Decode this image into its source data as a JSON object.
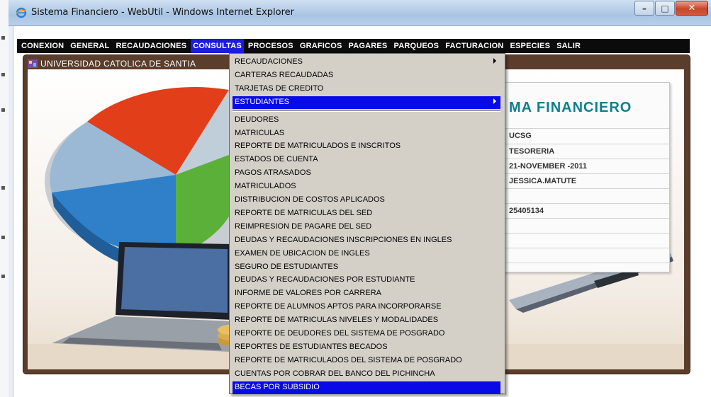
{
  "window": {
    "title": "Sistema Financiero - WebUtil - Windows Internet Explorer"
  },
  "menubar": {
    "items": [
      {
        "label": "CONEXION",
        "active": false
      },
      {
        "label": "GENERAL",
        "active": false
      },
      {
        "label": "RECAUDACIONES",
        "active": false
      },
      {
        "label": "CONSULTAS",
        "active": true
      },
      {
        "label": "PROCESOS",
        "active": false
      },
      {
        "label": "GRAFICOS",
        "active": false
      },
      {
        "label": "PAGARES",
        "active": false
      },
      {
        "label": "PARQUEOS",
        "active": false
      },
      {
        "label": "FACTURACION",
        "active": false
      },
      {
        "label": "ESPECIES",
        "active": false
      },
      {
        "label": "SALIR",
        "active": false
      }
    ]
  },
  "app": {
    "header": "UNIVERSIDAD CATOLICA DE SANTIA"
  },
  "card": {
    "title": "MA  FINANCIERO",
    "rows": [
      "UCSG",
      "TESORERIA",
      "21-NOVEMBER -2011",
      "JESSICA.MATUTE",
      "",
      "25405134",
      "",
      "",
      "",
      ""
    ]
  },
  "dropdown": {
    "items": [
      {
        "label": "RECAUDACIONES",
        "submenu": true,
        "highlighted": false
      },
      {
        "label": "CARTERAS RECAUDADAS",
        "submenu": false,
        "highlighted": false
      },
      {
        "label": "TARJETAS DE CREDITO",
        "submenu": false,
        "highlighted": false
      },
      {
        "label": "ESTUDIANTES",
        "submenu": true,
        "highlighted": true
      },
      {
        "label": "DEUDORES",
        "submenu": false,
        "highlighted": false
      },
      {
        "label": "MATRICULAS",
        "submenu": false,
        "highlighted": false
      },
      {
        "label": "REPORTE DE MATRICULADOS E INSCRITOS",
        "submenu": false,
        "highlighted": false
      },
      {
        "label": "ESTADOS DE CUENTA",
        "submenu": false,
        "highlighted": false
      },
      {
        "label": "PAGOS ATRASADOS",
        "submenu": false,
        "highlighted": false
      },
      {
        "label": "MATRICULADOS",
        "submenu": false,
        "highlighted": false
      },
      {
        "label": "DISTRIBUCION DE COSTOS APLICADOS",
        "submenu": false,
        "highlighted": false
      },
      {
        "label": "REPORTE DE MATRICULAS DEL SED",
        "submenu": false,
        "highlighted": false
      },
      {
        "label": "REIMPRESION DE PAGARE DEL SED",
        "submenu": false,
        "highlighted": false
      },
      {
        "label": "DEUDAS Y RECAUDACIONES INSCRIPCIONES EN INGLES",
        "submenu": false,
        "highlighted": false
      },
      {
        "label": "EXAMEN DE UBICACION DE INGLES",
        "submenu": false,
        "highlighted": false
      },
      {
        "label": "SEGURO DE ESTUDIANTES",
        "submenu": false,
        "highlighted": false
      },
      {
        "label": "DEUDAS Y RECAUDACIONES POR ESTUDIANTE",
        "submenu": false,
        "highlighted": false
      },
      {
        "label": "INFORME DE VALORES POR CARRERA",
        "submenu": false,
        "highlighted": false
      },
      {
        "label": "REPORTE DE ALUMNOS APTOS PARA INCORPORARSE",
        "submenu": false,
        "highlighted": false
      },
      {
        "label": "REPORTE DE MATRICULAS NIVELES Y MODALIDADES",
        "submenu": false,
        "highlighted": false
      },
      {
        "label": "REPORTE DE DEUDORES DEL SISTEMA DE POSGRADO",
        "submenu": false,
        "highlighted": false
      },
      {
        "label": "REPORTES DE ESTUDIANTES BECADOS",
        "submenu": false,
        "highlighted": false
      },
      {
        "label": "REPORTE DE MATRICULADOS DEL SISTEMA DE POSGRADO",
        "submenu": false,
        "highlighted": false
      },
      {
        "label": "CUENTAS POR COBRAR DEL BANCO DEL PICHINCHA",
        "submenu": false,
        "highlighted": false
      },
      {
        "label": "BECAS POR SUBSIDIO",
        "submenu": false,
        "highlighted": true
      }
    ]
  },
  "colors": {
    "menubar": "#0b0b0b",
    "highlight": "#0a0ae6",
    "frame": "#5a3d2b",
    "card_title": "#0d7f90"
  }
}
